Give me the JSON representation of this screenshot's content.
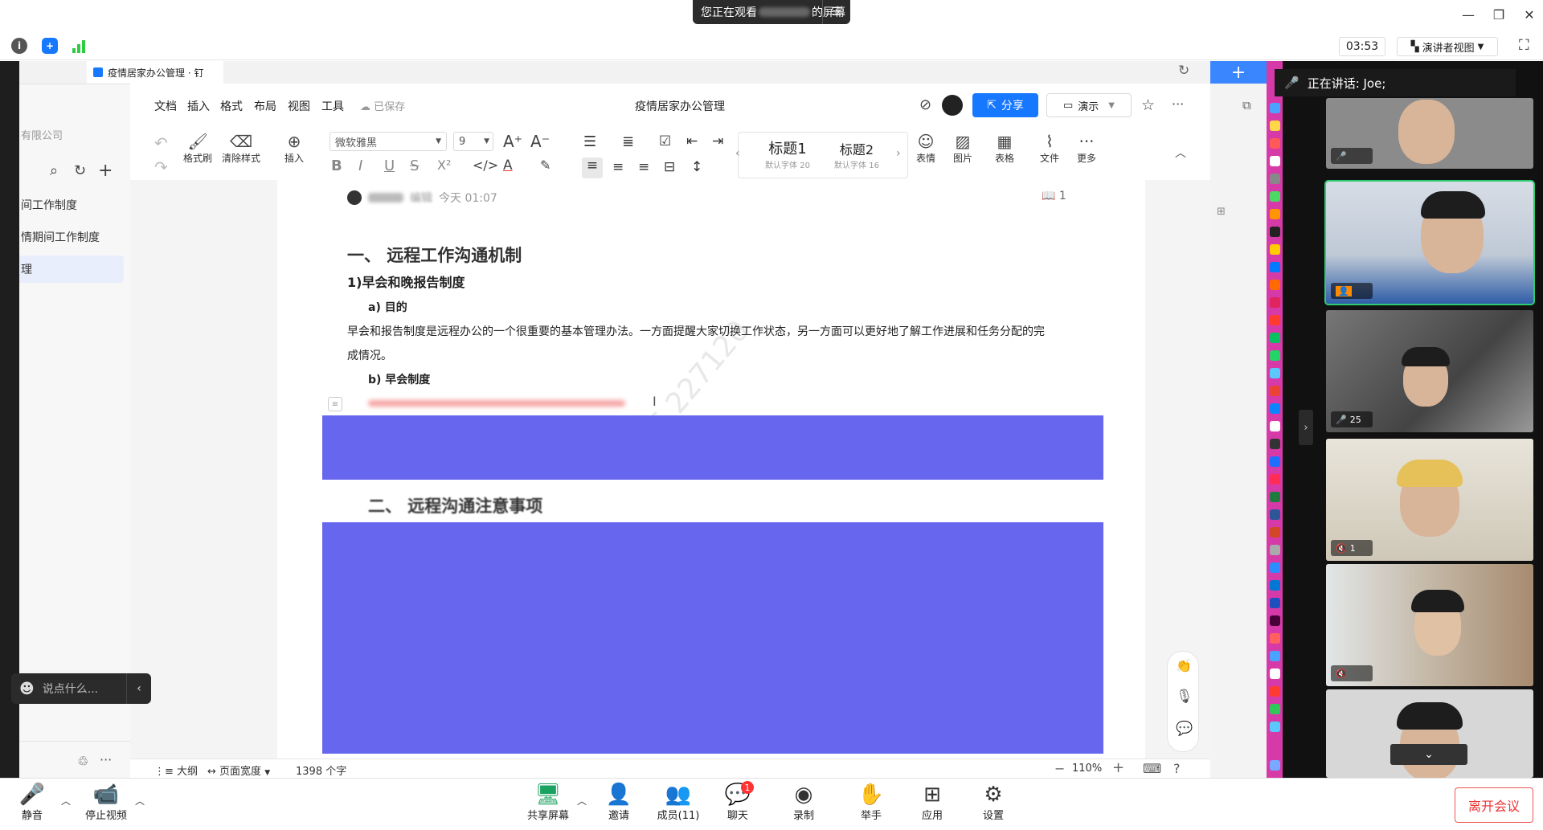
{
  "window": {
    "share_status_prefix": "您正在观看",
    "share_status_suffix": "的屏幕",
    "minimize": "—",
    "restore": "❐",
    "close": "✕"
  },
  "meeting_top": {
    "timer": "03:53",
    "view_mode": "演讲者视图"
  },
  "doc_tab": {
    "title": "疫情居家办公管理 · 钉"
  },
  "doc_sidebar": {
    "org_fragment": "有限公司",
    "top_fragment": "总",
    "items": [
      {
        "label": "间工作制度"
      },
      {
        "label": "情期间工作制度"
      },
      {
        "label": "理"
      }
    ]
  },
  "menubar": {
    "items": [
      "文档",
      "插入",
      "格式",
      "布局",
      "视图",
      "工具"
    ],
    "saved": "已保存",
    "title": "疫情居家办公管理",
    "share": "分享",
    "present": "演示"
  },
  "toolbar": {
    "format_painter": "格式刷",
    "clear_style": "清除样式",
    "insert": "插入",
    "font_family": "微软雅黑",
    "font_size": "9",
    "heading1": "标题1",
    "heading1_sub": "默认字体 20",
    "heading2": "标题2",
    "heading2_sub": "默认字体 16",
    "emoji": "表情",
    "image": "图片",
    "table": "表格",
    "file": "文件",
    "more": "更多"
  },
  "doc": {
    "meta_action": "编辑",
    "meta_time": "今天 01:07",
    "readers": "1",
    "h1_a": "一、 远程工作沟通机制",
    "h2_a": "1)早会和晚报告制度",
    "h3_a": "a) 目的",
    "para_1": "早会和报告制度是远程办公的一个很重要的基本管理办法。一方面提醒大家切换工作状态，另一方面可以更好地了解工作进展和任务分配的完",
    "para_2": "成情况。",
    "h3_b": "b) 早会制度",
    "h1_b": "二、 远程沟通注意事项"
  },
  "statusbar": {
    "outline": "大纲",
    "page_width": "页面宽度",
    "word_count": "1398 个字",
    "zoom": "110%"
  },
  "chat": {
    "placeholder": "说点什么..."
  },
  "participants": {
    "speaking": "正在讲话: Joe;",
    "tiles": [
      {
        "label": ""
      },
      {
        "label": ""
      },
      {
        "label": "25"
      },
      {
        "label": "1"
      },
      {
        "label": ""
      },
      {
        "label": ""
      }
    ]
  },
  "bottombar": {
    "mute": "静音",
    "stop_video": "停止视频",
    "share_screen": "共享屏幕",
    "invite": "邀请",
    "members": "成员(11)",
    "chat": "聊天",
    "chat_badge": "1",
    "record": "录制",
    "raise_hand": "举手",
    "apps": "应用",
    "settings": "设置",
    "leave": "离开会议"
  },
  "colors": {
    "accent": "#1677ff",
    "redaction": "#6666ee",
    "dock": "#d63aa8",
    "leave": "#e33333"
  }
}
